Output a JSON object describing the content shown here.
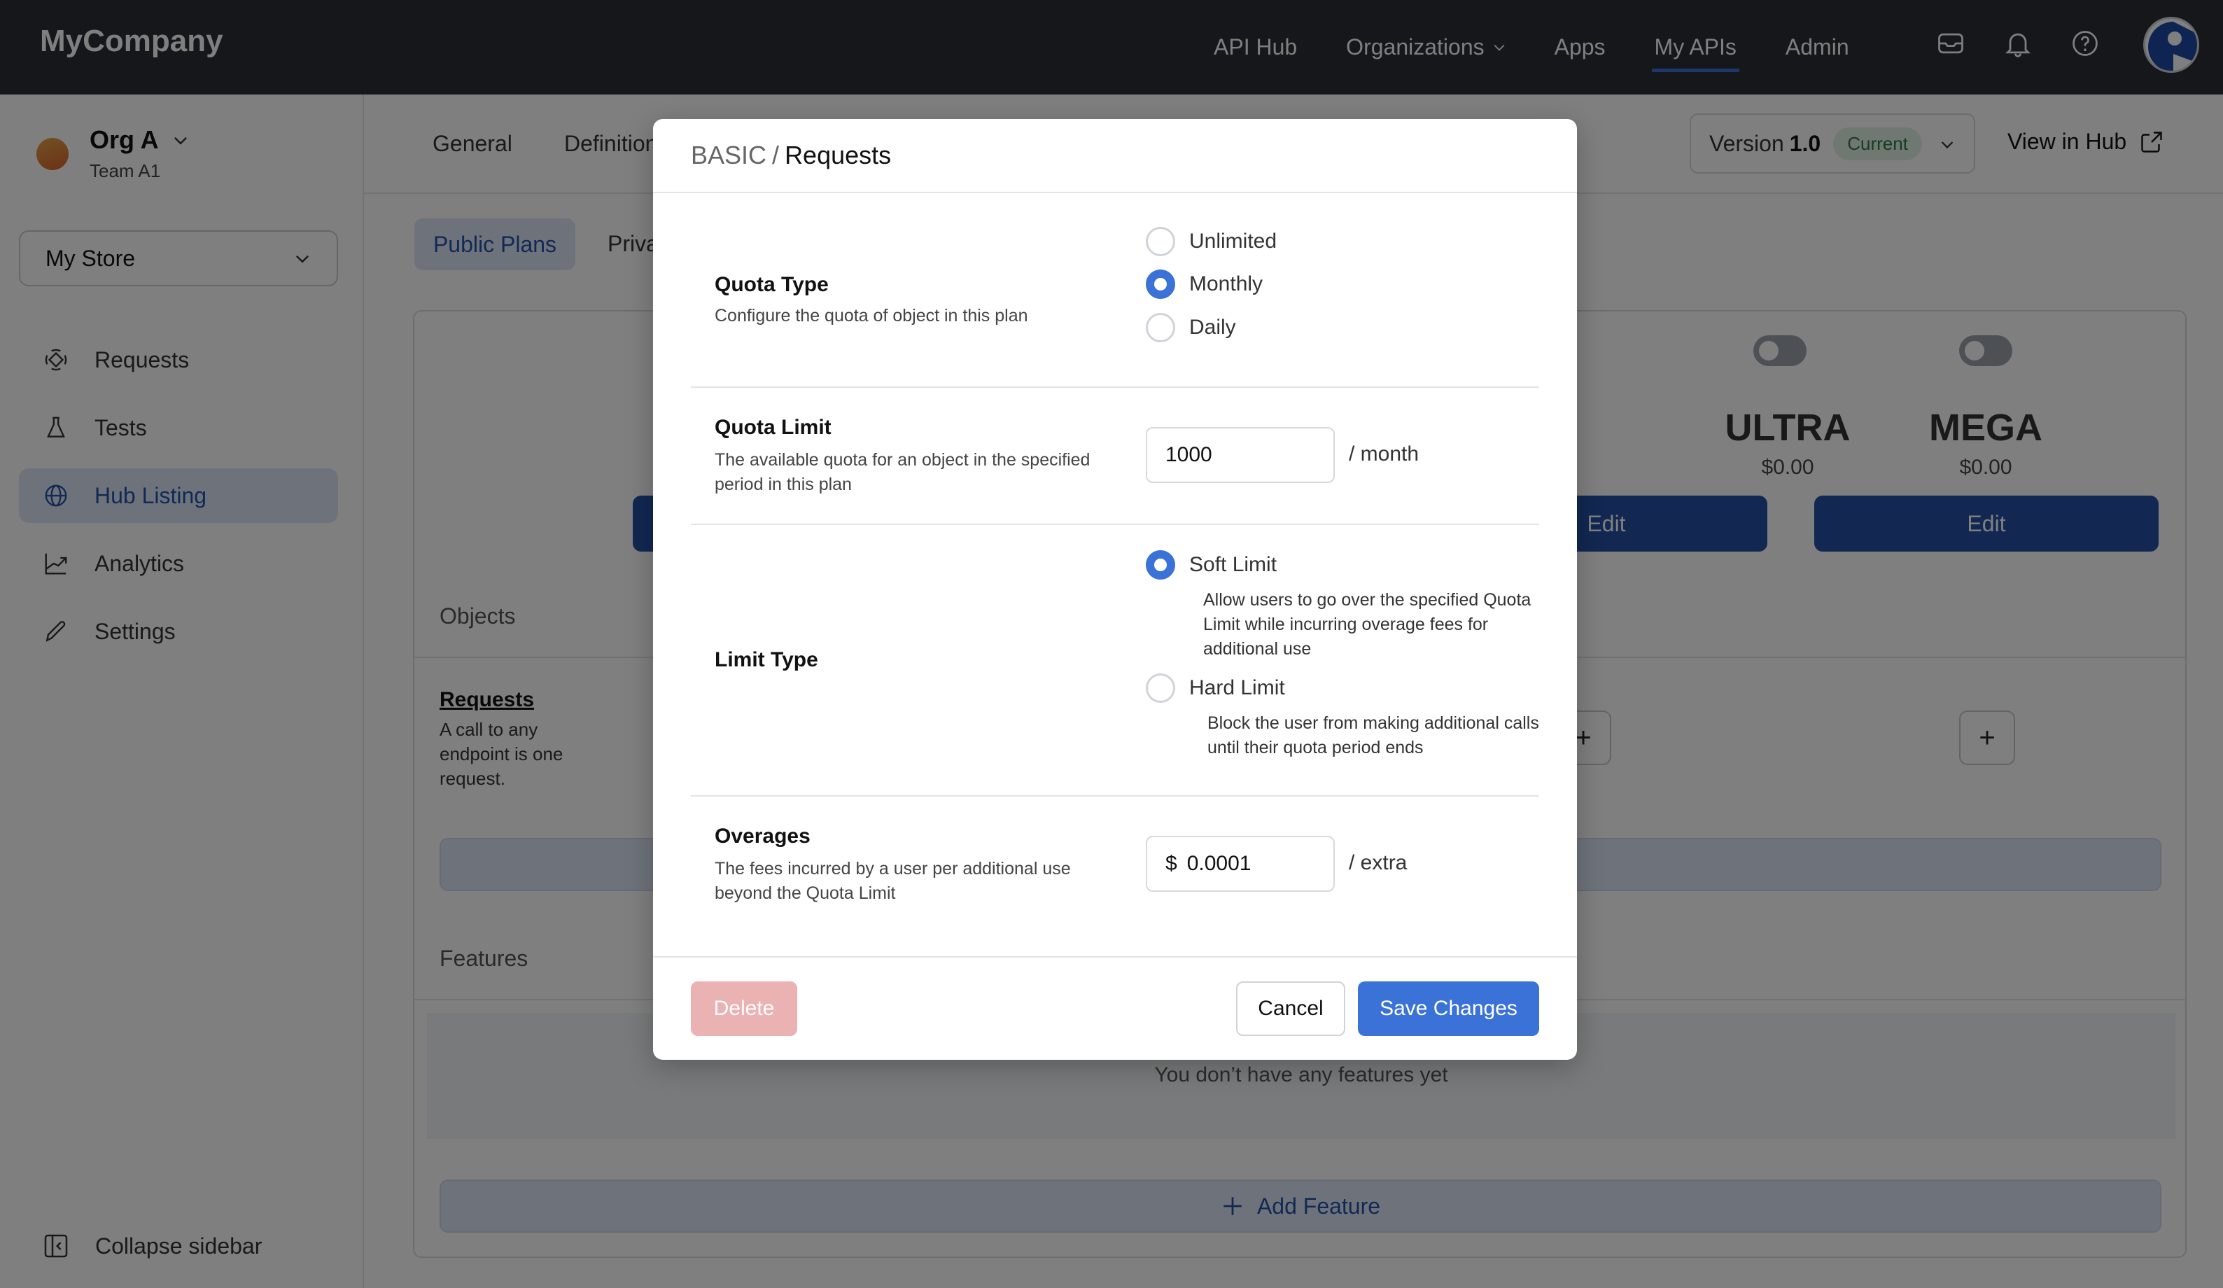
{
  "topnav": {
    "brand": "MyCompany",
    "links": [
      {
        "label": "API Hub",
        "active": false
      },
      {
        "label": "Organizations",
        "active": false,
        "dropdown": true
      },
      {
        "label": "Apps",
        "active": false
      },
      {
        "label": "My APIs",
        "active": true
      },
      {
        "label": "Admin",
        "active": false
      }
    ],
    "icons": [
      "inbox-icon",
      "bell-icon",
      "help-icon"
    ],
    "accent_color": "#3a6fd8"
  },
  "sidebar": {
    "org_name": "Org A",
    "team_name": "Team A1",
    "store_select": "My Store",
    "items": [
      {
        "label": "Requests",
        "icon": "requests-icon",
        "active": false
      },
      {
        "label": "Tests",
        "icon": "flask-icon",
        "active": false
      },
      {
        "label": "Hub Listing",
        "icon": "globe-icon",
        "active": true
      },
      {
        "label": "Analytics",
        "icon": "chart-line-icon",
        "active": false
      },
      {
        "label": "Settings",
        "icon": "pencil-icon",
        "active": false
      }
    ],
    "collapse_label": "Collapse sidebar"
  },
  "main": {
    "tabs": [
      "General",
      "Definition"
    ],
    "version_label": "Version",
    "version_number": "1.0",
    "version_badge": "Current",
    "view_in_hub": "View in Hub",
    "subtabs": [
      "Public Plans",
      "Private Plans"
    ],
    "plans": [
      {
        "name": "ULTRA",
        "price": "$0.00",
        "edit_label": "Edit"
      },
      {
        "name": "MEGA",
        "price": "$0.00",
        "edit_label": "Edit"
      }
    ],
    "objects_label": "Objects",
    "object": {
      "name": "Requests",
      "description": "A call to any endpoint is one request."
    },
    "features_label": "Features",
    "features_empty": "You don’t have any features yet",
    "add_feature_label": "Add Feature"
  },
  "modal": {
    "breadcrumb_parent": "BASIC",
    "breadcrumb_separator": "/",
    "breadcrumb_current": "Requests",
    "quota_type": {
      "title": "Quota Type",
      "description": "Configure the quota of object in this plan",
      "options": [
        "Unlimited",
        "Monthly",
        "Daily"
      ],
      "selected": "Monthly"
    },
    "quota_limit": {
      "title": "Quota Limit",
      "description": "The available quota for an object in the specified period in this plan",
      "value": "1000",
      "suffix": "/ month"
    },
    "limit_type": {
      "title": "Limit Type",
      "options": [
        {
          "label": "Soft Limit",
          "description": "Allow users to go over the specified Quota Limit while incurring overage fees for additional use"
        },
        {
          "label": "Hard Limit",
          "description": "Block the user from making additional calls until their quota period ends"
        }
      ],
      "selected": "Soft Limit"
    },
    "overages": {
      "title": "Overages",
      "description": "The fees incurred by a user per additional use beyond the Quota Limit",
      "currency": "$",
      "value": "0.0001",
      "suffix": "/ extra"
    },
    "delete_label": "Delete",
    "cancel_label": "Cancel",
    "save_label": "Save Changes",
    "primary_color": "#3a72d8",
    "delete_color": "#eab2b2"
  }
}
